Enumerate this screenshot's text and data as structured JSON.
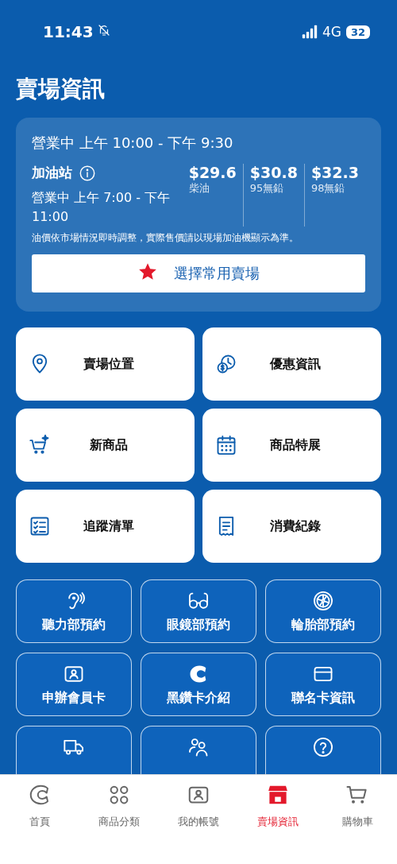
{
  "status_bar": {
    "time": "11:43",
    "network": "4G",
    "battery": "32"
  },
  "title": "賣場資訊",
  "store_info": {
    "hours": "營業中 上午 10:00 - 下午 9:30",
    "gas_station": {
      "name": "加油站",
      "hours": "營業中 上午 7:00 - 下午 11:00",
      "prices": [
        {
          "price": "$29.6",
          "label": "柴油"
        },
        {
          "price": "$30.8",
          "label": "95無鉛"
        },
        {
          "price": "$32.3",
          "label": "98無鉛"
        }
      ]
    },
    "note": "油價依市場情況即時調整，實際售價請以現場加油機顯示為準。",
    "favorite_button": "選擇常用賣場"
  },
  "feature_cards": [
    {
      "label": "賣場位置"
    },
    {
      "label": "優惠資訊"
    },
    {
      "label": "新商品"
    },
    {
      "label": "商品特展"
    },
    {
      "label": "追蹤清單"
    },
    {
      "label": "消費紀錄"
    }
  ],
  "service_buttons": [
    {
      "kind": "full",
      "label": "聽力部預約"
    },
    {
      "kind": "full",
      "label": "眼鏡部預約"
    },
    {
      "kind": "full",
      "label": "輪胎部預約"
    },
    {
      "kind": "full",
      "label": "申辦會員卡"
    },
    {
      "kind": "full",
      "label": "黑鑽卡介紹"
    },
    {
      "kind": "full",
      "label": "聯名卡資訊"
    },
    {
      "kind": "cut_off"
    },
    {
      "kind": "cut_off"
    },
    {
      "kind": "cut_off"
    }
  ],
  "tab_bar": [
    {
      "label": "首頁",
      "selected": false
    },
    {
      "label": "商品分類",
      "selected": false
    },
    {
      "label": "我的帳號",
      "selected": false
    },
    {
      "label": "賣場資訊",
      "selected": true
    },
    {
      "label": "購物車",
      "selected": false
    }
  ]
}
